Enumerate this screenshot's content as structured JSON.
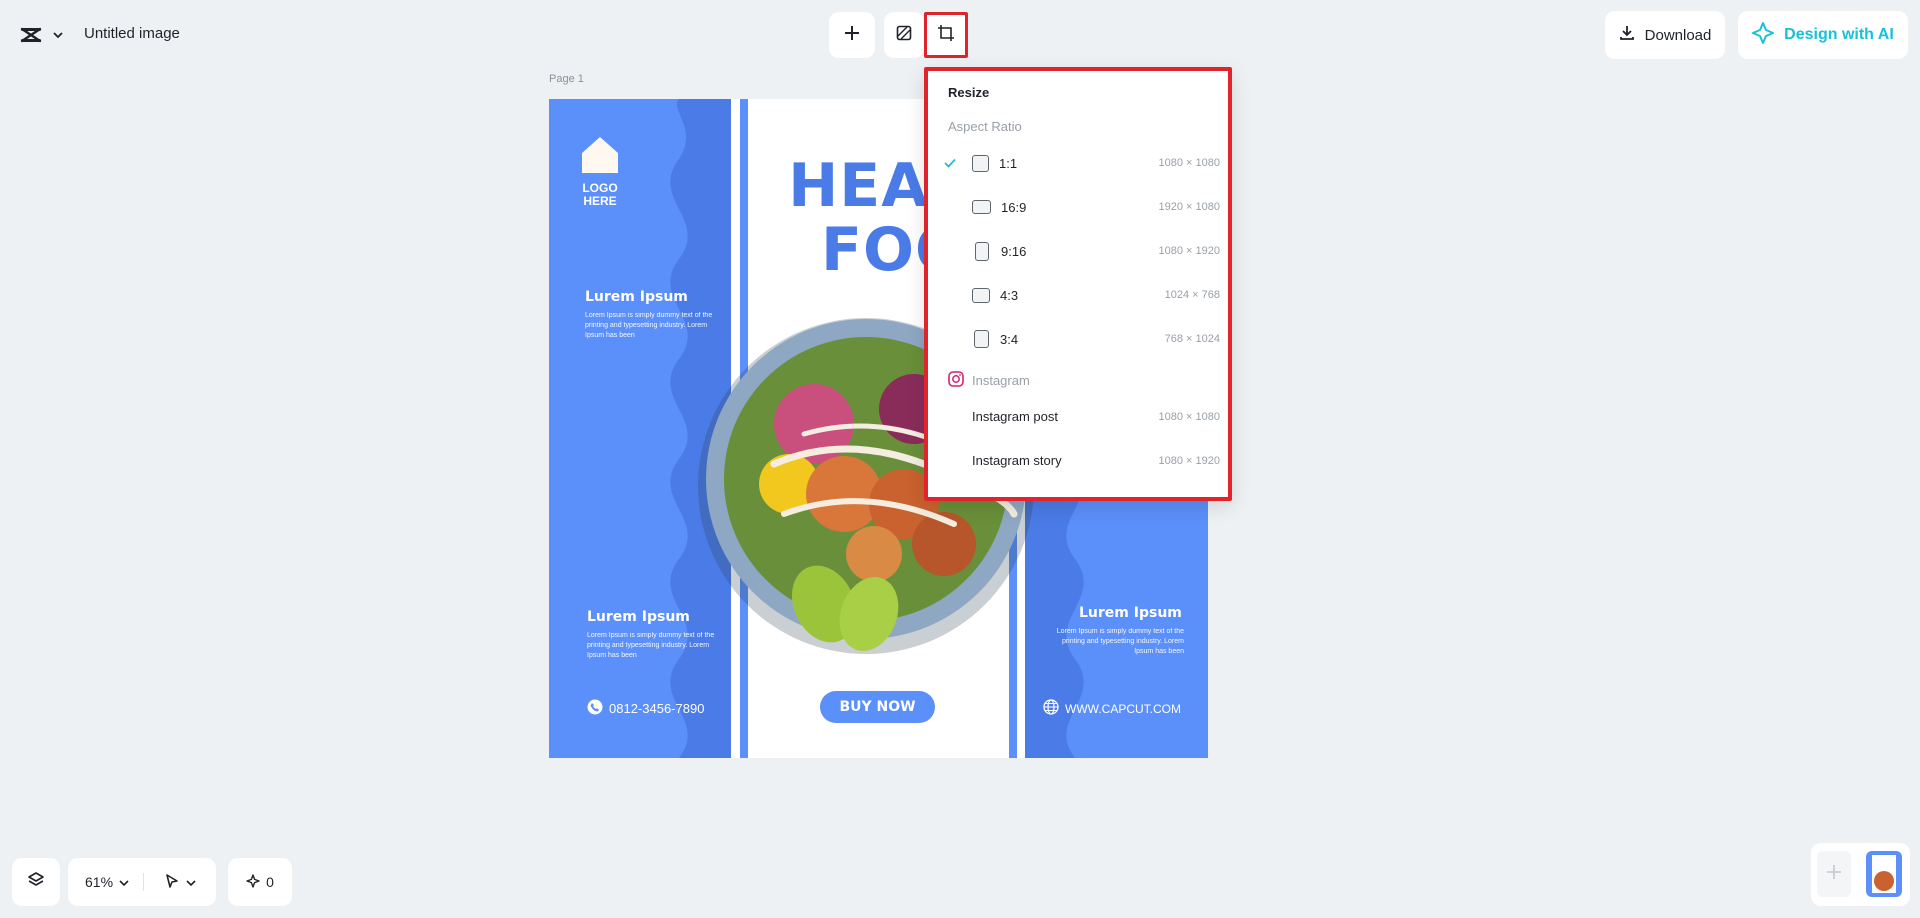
{
  "header": {
    "title": "Untitled image",
    "download_label": "Download",
    "design_ai_label": "Design with AI"
  },
  "page_label": "Page 1",
  "design": {
    "headline_line1": "HEALT",
    "headline_line2": "FOO",
    "logo_line1": "LOGO",
    "logo_line2": "HERE",
    "lorem_heading": "Lurem Ipsum",
    "lorem_text_1": "Lorem Ipsum is simply dummy text of the printing and typesetting industry. Lorem Ipsum has been",
    "lorem_text_2": "Lorem Ipsum is simply dummy text of the printing and typesetting industry. Lorem Ipsum has been",
    "lorem_text_3": "Lorem Ipsum is simply dummy text of the printing and typesetting industry. Lorem Ipsum has been",
    "phone": "0812-3456-7890",
    "website": "WWW.CAPCUT.COM",
    "buy_now": "BUY NOW",
    "colors": {
      "primary": "#5b8ff9",
      "headline": "#4a7be6"
    }
  },
  "resize_menu": {
    "title": "Resize",
    "aspect_ratio_heading": "Aspect Ratio",
    "ratios": [
      {
        "label": "1:1",
        "dims": "1080 × 1080",
        "selected": true
      },
      {
        "label": "16:9",
        "dims": "1920 × 1080",
        "selected": false
      },
      {
        "label": "9:16",
        "dims": "1080 × 1920",
        "selected": false
      },
      {
        "label": "4:3",
        "dims": "1024 × 768",
        "selected": false
      },
      {
        "label": "3:4",
        "dims": "768 × 1024",
        "selected": false
      }
    ],
    "instagram_heading": "Instagram",
    "instagram": [
      {
        "label": "Instagram post",
        "dims": "1080 × 1080"
      },
      {
        "label": "Instagram story",
        "dims": "1080 × 1920"
      }
    ]
  },
  "bottom": {
    "zoom": "61%",
    "credits": "0"
  },
  "accent_color": "#17c2d6",
  "highlight_color": "#e0242c"
}
